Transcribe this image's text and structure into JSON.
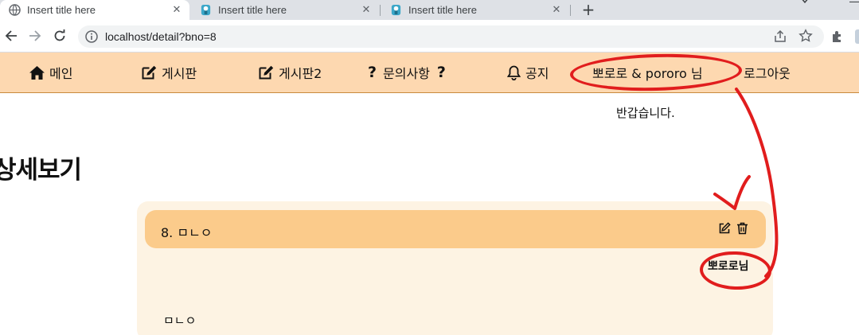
{
  "browser": {
    "tabs": [
      {
        "title": "Insert title here",
        "active": true
      },
      {
        "title": "Insert title here",
        "active": false
      },
      {
        "title": "Insert title here",
        "active": false
      }
    ],
    "new_tab_label": "+",
    "close_glyph": "✕",
    "address": "localhost/detail?bno=8"
  },
  "site_nav": {
    "items": [
      {
        "id": "main",
        "label": "메인",
        "icon": "home-icon"
      },
      {
        "id": "board",
        "label": "게시판",
        "icon": "edit-icon"
      },
      {
        "id": "board2",
        "label": "게시판2",
        "icon": "edit-icon"
      },
      {
        "id": "inquiry",
        "label": "문의사항",
        "icon": "question-icon"
      },
      {
        "id": "notice",
        "label": "공지",
        "icon": "bell-icon"
      }
    ],
    "question_glyph": "?",
    "user_greeting": "뽀로로 & pororo 님",
    "logout_label": "로그아웃",
    "welcome_text": "반갑습니다."
  },
  "page": {
    "title": "상세보기"
  },
  "post": {
    "header": "8. ㅁㄴㅇ",
    "author": "뽀로로님",
    "content": "ㅁㄴㅇ"
  },
  "colors": {
    "nav_bg": "#fdd8b0",
    "header_bg": "#fbcb8b",
    "panel_bg": "#fdf3e3",
    "annotation_red": "#e11d1d"
  }
}
